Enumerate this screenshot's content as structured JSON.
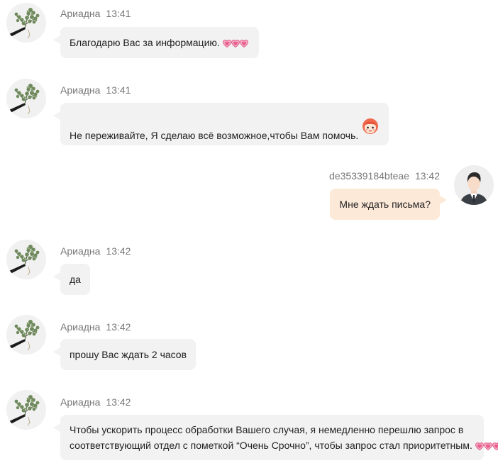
{
  "messages": [
    {
      "sender": "Ариадна",
      "time": "13:41",
      "direction": "incoming",
      "text": "Благодарю Вас за информацию.",
      "emoji": "three-pink-hearts"
    },
    {
      "sender": "Ариадна",
      "time": "13:41",
      "direction": "incoming",
      "text": "Не переживайте, Я сделаю всё возможное,чтобы Вам помочь.",
      "emoji": "cartoon-girl-face"
    },
    {
      "sender": "de35339184bteae",
      "time": "13:42",
      "direction": "outgoing",
      "text": "Мне ждать письма?"
    },
    {
      "sender": "Ариадна",
      "time": "13:42",
      "direction": "incoming",
      "text": "да"
    },
    {
      "sender": "Ариадна",
      "time": "13:42",
      "direction": "incoming",
      "text": "прошу Вас ждать 2 часов"
    },
    {
      "sender": "Ариадна",
      "time": "13:42",
      "direction": "incoming",
      "text_line1": "Чтобы ускорить процесс обработки Вашего случая, я немедленно перешлю запрос в",
      "text_line2": "соответствующий отдел с пометкой “Очень Срочно”, чтобы запрос стал приоритетным.",
      "emoji": "three-pink-hearts"
    }
  ],
  "colors": {
    "incoming_bubble": "#f2f2f2",
    "outgoing_bubble": "#fde9d8",
    "meta_text": "#777777",
    "heart": "#e85b8a"
  },
  "icons": {
    "agent_avatar": "eucalyptus-plant-avatar",
    "user_avatar": "man-in-suit-avatar"
  }
}
